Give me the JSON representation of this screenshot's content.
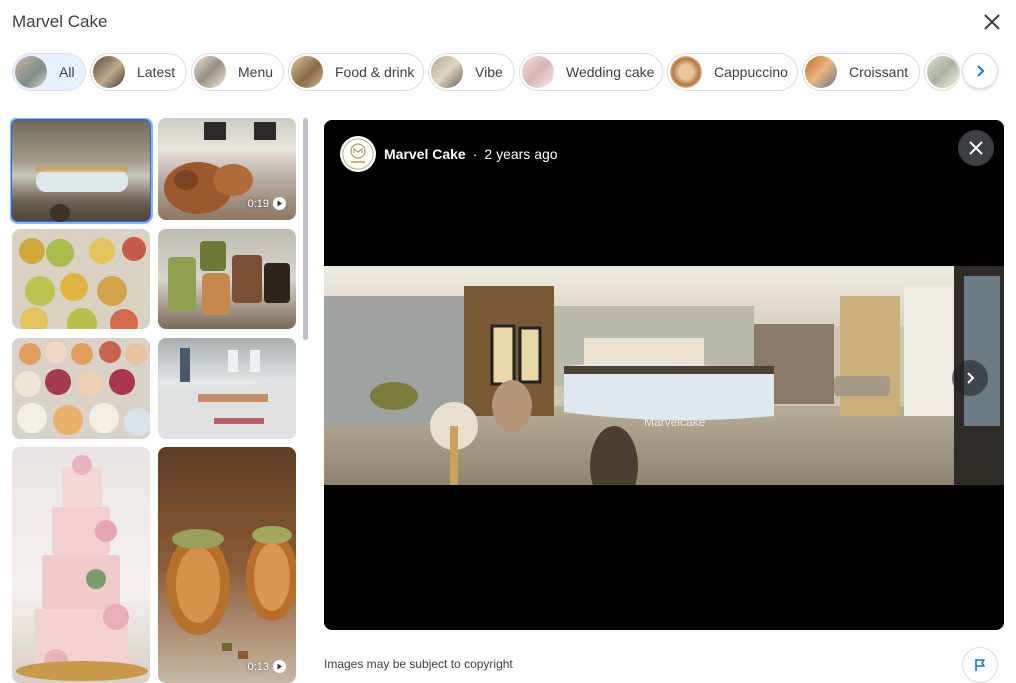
{
  "header": {
    "title": "Marvel Cake"
  },
  "chips": [
    {
      "label": "All",
      "active": true
    },
    {
      "label": "Latest"
    },
    {
      "label": "Menu"
    },
    {
      "label": "Food & drink"
    },
    {
      "label": "Vibe"
    },
    {
      "label": "Wedding cake"
    },
    {
      "label": "Cappuccino"
    },
    {
      "label": "Croissant"
    },
    {
      "label": ""
    }
  ],
  "grid": {
    "tiles": [
      {
        "kind": "photo",
        "subject": "bakery interior"
      },
      {
        "kind": "video",
        "subject": "pastries",
        "duration": "0:19"
      },
      {
        "kind": "photo",
        "subject": "macaron desserts"
      },
      {
        "kind": "photo",
        "subject": "croissant slices"
      },
      {
        "kind": "photo",
        "subject": "macarons"
      },
      {
        "kind": "photo",
        "subject": "bakery staff"
      },
      {
        "kind": "photo",
        "subject": "wedding cake"
      },
      {
        "kind": "video",
        "subject": "croissant rolls",
        "duration": "0:13"
      }
    ]
  },
  "viewer": {
    "author": "Marvel Cake",
    "separator": "·",
    "time": "2 years ago",
    "watermark": "Marvelcake"
  },
  "footer": {
    "copyright": "Images may be subject to copyright"
  },
  "colors": {
    "accent": "#1a73e8",
    "active_chip_bg": "#e8f0fe",
    "viewer_bg": "#000000"
  }
}
